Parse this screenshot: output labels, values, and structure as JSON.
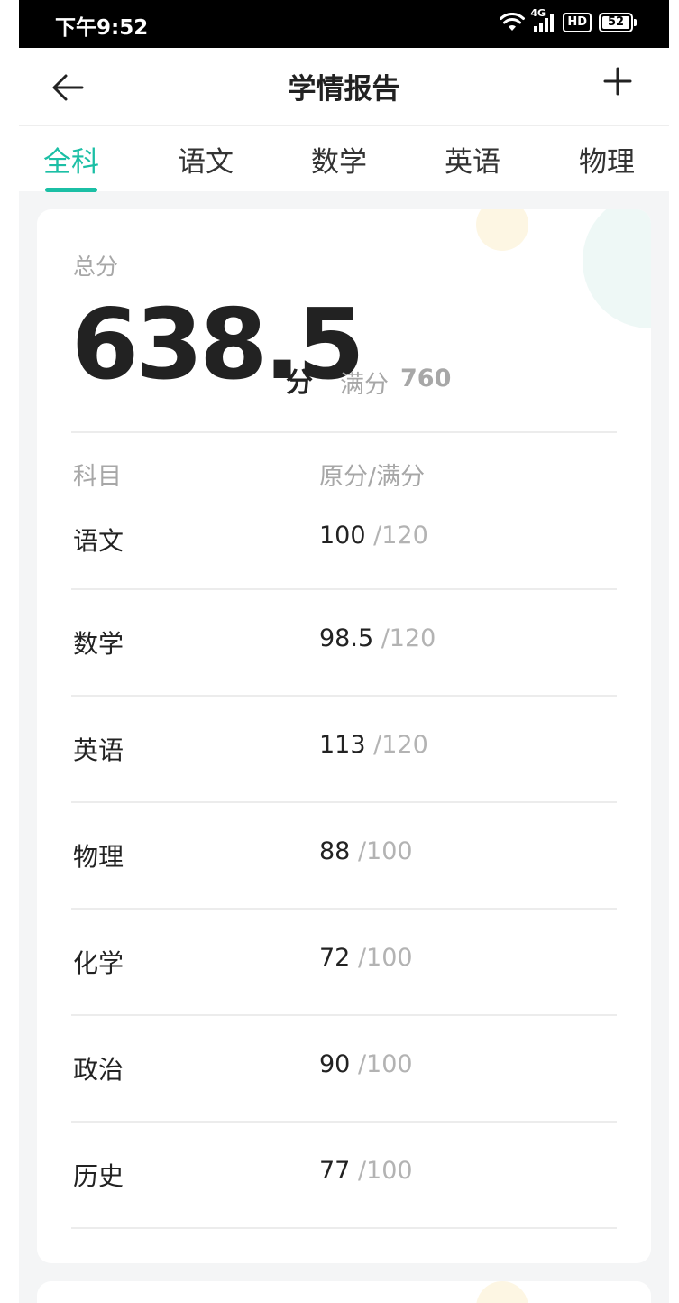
{
  "status_bar": {
    "time": "下午9:52",
    "network": "4G",
    "hd": "HD",
    "battery": "52"
  },
  "nav": {
    "title": "学情报告",
    "back_icon": "arrow-left-icon",
    "add_icon": "plus-icon"
  },
  "tabs": [
    {
      "label": "全科",
      "active": true
    },
    {
      "label": "语文",
      "active": false
    },
    {
      "label": "数学",
      "active": false
    },
    {
      "label": "英语",
      "active": false
    },
    {
      "label": "物理",
      "active": false
    }
  ],
  "summary": {
    "total_label": "总分",
    "total_score": "638.5",
    "unit": "分",
    "full_label": "满分",
    "full_value": "760"
  },
  "table": {
    "headers": {
      "subject": "科目",
      "score": "原分/满分"
    },
    "rows": [
      {
        "subject": "语文",
        "raw": "100",
        "full": " /120"
      },
      {
        "subject": "数学",
        "raw": "98.5",
        "full": " /120"
      },
      {
        "subject": "英语",
        "raw": "113",
        "full": " /120"
      },
      {
        "subject": "物理",
        "raw": "88",
        "full": " /100"
      },
      {
        "subject": "化学",
        "raw": "72",
        "full": " /100"
      },
      {
        "subject": "政治",
        "raw": "90",
        "full": " /100"
      },
      {
        "subject": "历史",
        "raw": "77",
        "full": " /100"
      }
    ]
  },
  "colors": {
    "accent": "#1bbfa5",
    "text_primary": "#222222",
    "text_muted": "#a7a7a7",
    "background": "#f4f5f6"
  }
}
